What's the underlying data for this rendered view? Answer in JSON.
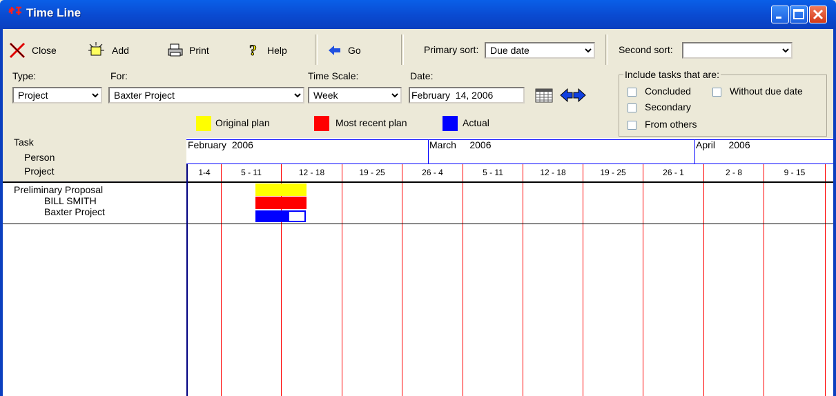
{
  "window": {
    "title": "Time Line"
  },
  "toolbar": {
    "close_label": "Close",
    "add_label": "Add",
    "print_label": "Print",
    "help_label": "Help",
    "go_label": "Go",
    "primary_sort_label": "Primary sort:",
    "primary_sort_value": "Due date",
    "second_sort_label": "Second sort:",
    "second_sort_value": ""
  },
  "filters": {
    "type_label": "Type:",
    "type_value": "Project",
    "for_label": "For:",
    "for_value": "Baxter Project",
    "time_scale_label": "Time Scale:",
    "time_scale_value": "Week",
    "date_label": "Date:",
    "date_value": "February  14, 2006"
  },
  "include": {
    "title": "Include tasks that are:",
    "concluded": "Concluded",
    "without_due_date": "Without due date",
    "secondary": "Secondary",
    "from_others": "From others"
  },
  "legend": {
    "original_plan": "Original plan",
    "most_recent_plan": "Most recent plan",
    "actual": "Actual",
    "colors": {
      "original": "#ffff00",
      "recent": "#ff0000",
      "actual": "#0000ff"
    }
  },
  "grid_header": {
    "task": "Task",
    "person": "Person",
    "project": "Project",
    "months": [
      {
        "name": "February",
        "year": "2006"
      },
      {
        "name": "March",
        "year": "2006"
      },
      {
        "name": "April",
        "year": "2006"
      }
    ],
    "weeks": [
      "1-4",
      "5 - 11",
      "12 - 18",
      "19 - 25",
      "26 - 4",
      "5 - 11",
      "12 - 18",
      "19 - 25",
      "26 - 1",
      "2 - 8",
      "9 - 15"
    ]
  },
  "tasks": [
    {
      "task": "Preliminary Proposal",
      "person": "BILL SMITH",
      "project": "Baxter Project"
    }
  ]
}
